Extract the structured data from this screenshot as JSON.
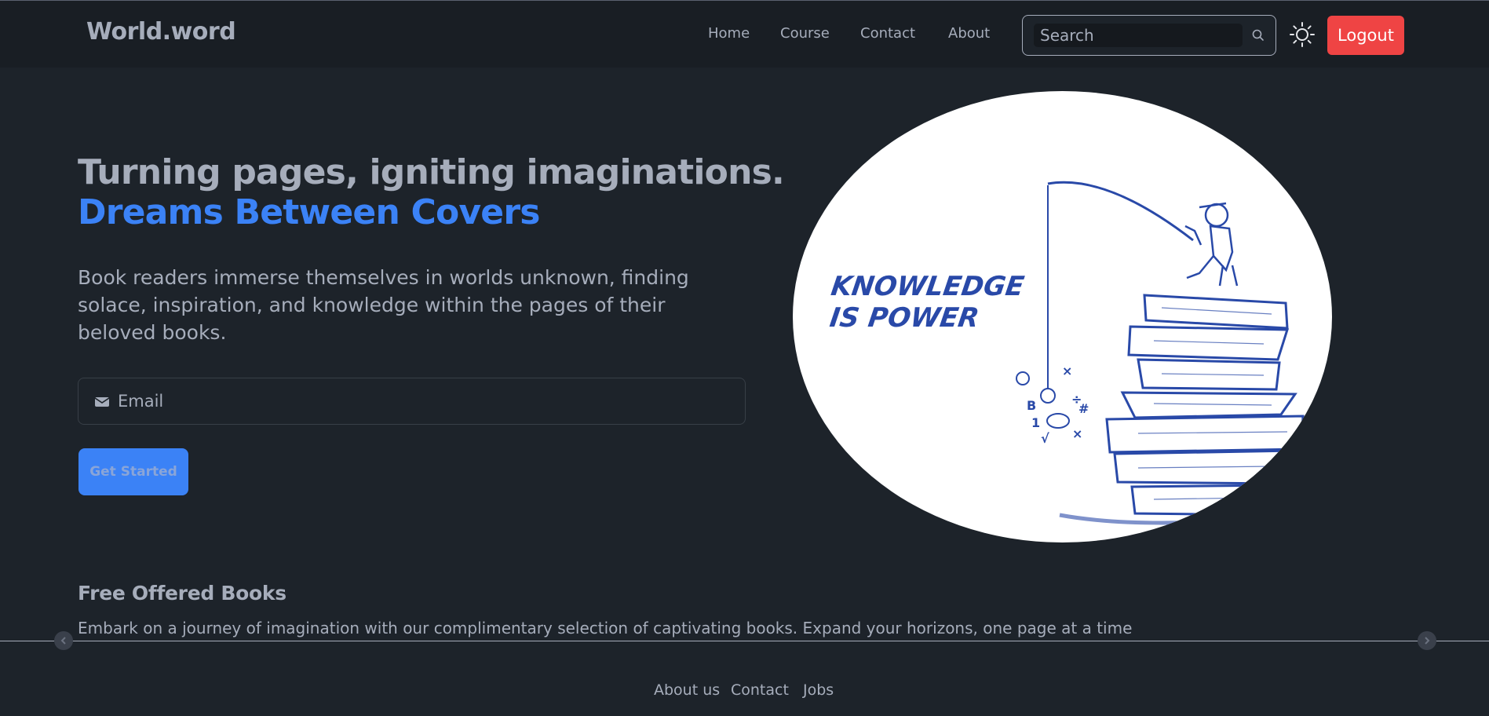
{
  "header": {
    "brand": "World.word",
    "nav": [
      "Home",
      "Course",
      "Contact",
      "About"
    ],
    "search_placeholder": "Search",
    "logout_label": "Logout"
  },
  "hero": {
    "title": "Turning pages, igniting imaginations.",
    "title_accent": "Dreams Between Covers",
    "description": "Book readers immerse themselves in worlds unknown, finding solace, inspiration, and knowledge within the pages of their beloved books.",
    "email_placeholder": "Email",
    "cta_label": "Get Started",
    "image_text": [
      "KNOWLEDGE",
      "IS POWER"
    ]
  },
  "books_section": {
    "title": "Free Offered Books",
    "description": "Embark on a journey of imagination with our complimentary selection of captivating books. Expand your horizons, one page at a time"
  },
  "footer": {
    "links": [
      "About us",
      "Contact",
      "Jobs"
    ]
  },
  "colors": {
    "background": "#1d232a",
    "navbar": "#191e24",
    "text": "#a6adbb",
    "accent": "#3b82f6",
    "danger": "#ef4444"
  },
  "icons": [
    "search-icon",
    "sun-icon",
    "mail-icon",
    "chevron-left-icon",
    "chevron-right-icon"
  ]
}
